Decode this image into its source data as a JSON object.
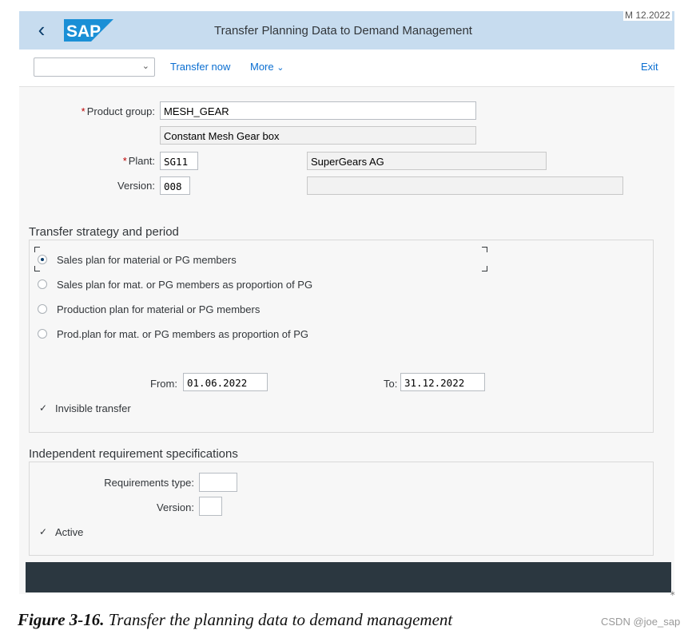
{
  "header": {
    "title": "Transfer Planning Data to Demand Management",
    "logo_text": "SAP",
    "date_fragment": "M 12.2022",
    "back_icon": "chevron-left-icon"
  },
  "toolbar": {
    "select_value": "",
    "transfer_now": "Transfer now",
    "more": "More",
    "exit": "Exit"
  },
  "form": {
    "product_group_label": "Product group:",
    "product_group_value": "MESH_GEAR",
    "product_group_desc": "Constant Mesh Gear box",
    "plant_label": "Plant:",
    "plant_value": "SG11",
    "plant_desc": "SuperGears AG",
    "version_label": "Version:",
    "version_value": "008",
    "version_desc": "",
    "required_marker": "*"
  },
  "strategy": {
    "title": "Transfer strategy and period",
    "options": [
      {
        "label": "Sales plan for material or PG members",
        "selected": true
      },
      {
        "label": "Sales plan for mat. or PG members as proportion of PG",
        "selected": false
      },
      {
        "label": "Production plan for material or PG members",
        "selected": false
      },
      {
        "label": "Prod.plan for mat. or PG members as proportion of PG",
        "selected": false
      }
    ],
    "from_label": "From:",
    "from_value": "01.06.2022",
    "to_label": "To:",
    "to_value": "31.12.2022",
    "invisible_transfer_label": "Invisible transfer",
    "invisible_transfer_checked": true
  },
  "requirements": {
    "title": "Independent requirement specifications",
    "req_type_label": "Requirements type:",
    "req_type_value": "",
    "version_label": "Version:",
    "version_value": "",
    "active_label": "Active",
    "active_checked": true
  },
  "caption": {
    "figure": "Figure 3-16.",
    "text": "Transfer the planning data to demand management"
  },
  "watermark": "CSDN @joe_sap"
}
